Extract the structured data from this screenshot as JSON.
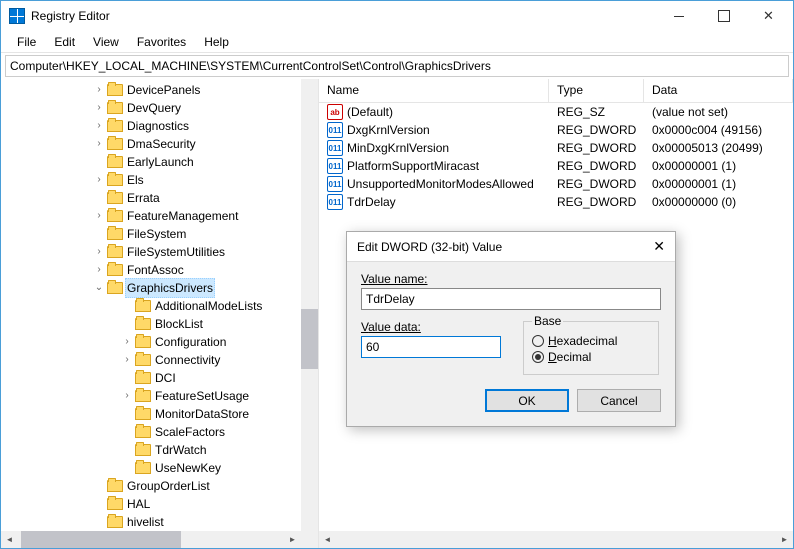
{
  "window": {
    "title": "Registry Editor"
  },
  "menu": {
    "file": "File",
    "edit": "Edit",
    "view": "View",
    "favorites": "Favorites",
    "help": "Help"
  },
  "address": "Computer\\HKEY_LOCAL_MACHINE\\SYSTEM\\CurrentControlSet\\Control\\GraphicsDrivers",
  "tree": {
    "items": [
      {
        "label": "DevicePanels",
        "exp": ">",
        "child": false
      },
      {
        "label": "DevQuery",
        "exp": ">",
        "child": false
      },
      {
        "label": "Diagnostics",
        "exp": ">",
        "child": false
      },
      {
        "label": "DmaSecurity",
        "exp": ">",
        "child": false
      },
      {
        "label": "EarlyLaunch",
        "exp": "",
        "child": false
      },
      {
        "label": "Els",
        "exp": ">",
        "child": false
      },
      {
        "label": "Errata",
        "exp": "",
        "child": false
      },
      {
        "label": "FeatureManagement",
        "exp": ">",
        "child": false
      },
      {
        "label": "FileSystem",
        "exp": "",
        "child": false
      },
      {
        "label": "FileSystemUtilities",
        "exp": ">",
        "child": false
      },
      {
        "label": "FontAssoc",
        "exp": ">",
        "child": false
      },
      {
        "label": "GraphicsDrivers",
        "exp": "v",
        "child": false,
        "selected": true
      },
      {
        "label": "AdditionalModeLists",
        "exp": "",
        "child": true
      },
      {
        "label": "BlockList",
        "exp": "",
        "child": true
      },
      {
        "label": "Configuration",
        "exp": ">",
        "child": true
      },
      {
        "label": "Connectivity",
        "exp": ">",
        "child": true
      },
      {
        "label": "DCI",
        "exp": "",
        "child": true
      },
      {
        "label": "FeatureSetUsage",
        "exp": ">",
        "child": true
      },
      {
        "label": "MonitorDataStore",
        "exp": "",
        "child": true
      },
      {
        "label": "ScaleFactors",
        "exp": "",
        "child": true
      },
      {
        "label": "TdrWatch",
        "exp": "",
        "child": true
      },
      {
        "label": "UseNewKey",
        "exp": "",
        "child": true
      },
      {
        "label": "GroupOrderList",
        "exp": "",
        "child": false
      },
      {
        "label": "HAL",
        "exp": "",
        "child": false
      },
      {
        "label": "hivelist",
        "exp": "",
        "child": false
      }
    ]
  },
  "list": {
    "headers": {
      "name": "Name",
      "type": "Type",
      "data": "Data"
    },
    "rows": [
      {
        "icon": "str",
        "name": "(Default)",
        "type": "REG_SZ",
        "data": "(value not set)"
      },
      {
        "icon": "dw",
        "name": "DxgKrnlVersion",
        "type": "REG_DWORD",
        "data": "0x0000c004 (49156)"
      },
      {
        "icon": "dw",
        "name": "MinDxgKrnlVersion",
        "type": "REG_DWORD",
        "data": "0x00005013 (20499)"
      },
      {
        "icon": "dw",
        "name": "PlatformSupportMiracast",
        "type": "REG_DWORD",
        "data": "0x00000001 (1)"
      },
      {
        "icon": "dw",
        "name": "UnsupportedMonitorModesAllowed",
        "type": "REG_DWORD",
        "data": "0x00000001 (1)"
      },
      {
        "icon": "dw",
        "name": "TdrDelay",
        "type": "REG_DWORD",
        "data": "0x00000000 (0)"
      }
    ]
  },
  "dialog": {
    "title": "Edit DWORD (32-bit) Value",
    "valueNameLabelPrefix": "V",
    "valueNameLabel": "alue name:",
    "valueName": "TdrDelay",
    "valueDataLabelPrefix": "V",
    "valueDataLabel": "alue data:",
    "valueData": "60",
    "baseLabel": "Base",
    "hexLabelPrefix": "H",
    "hexLabel": "exadecimal",
    "decLabelPrefix": "D",
    "decLabel": "ecimal",
    "selectedBase": "decimal",
    "ok": "OK",
    "cancel": "Cancel"
  }
}
